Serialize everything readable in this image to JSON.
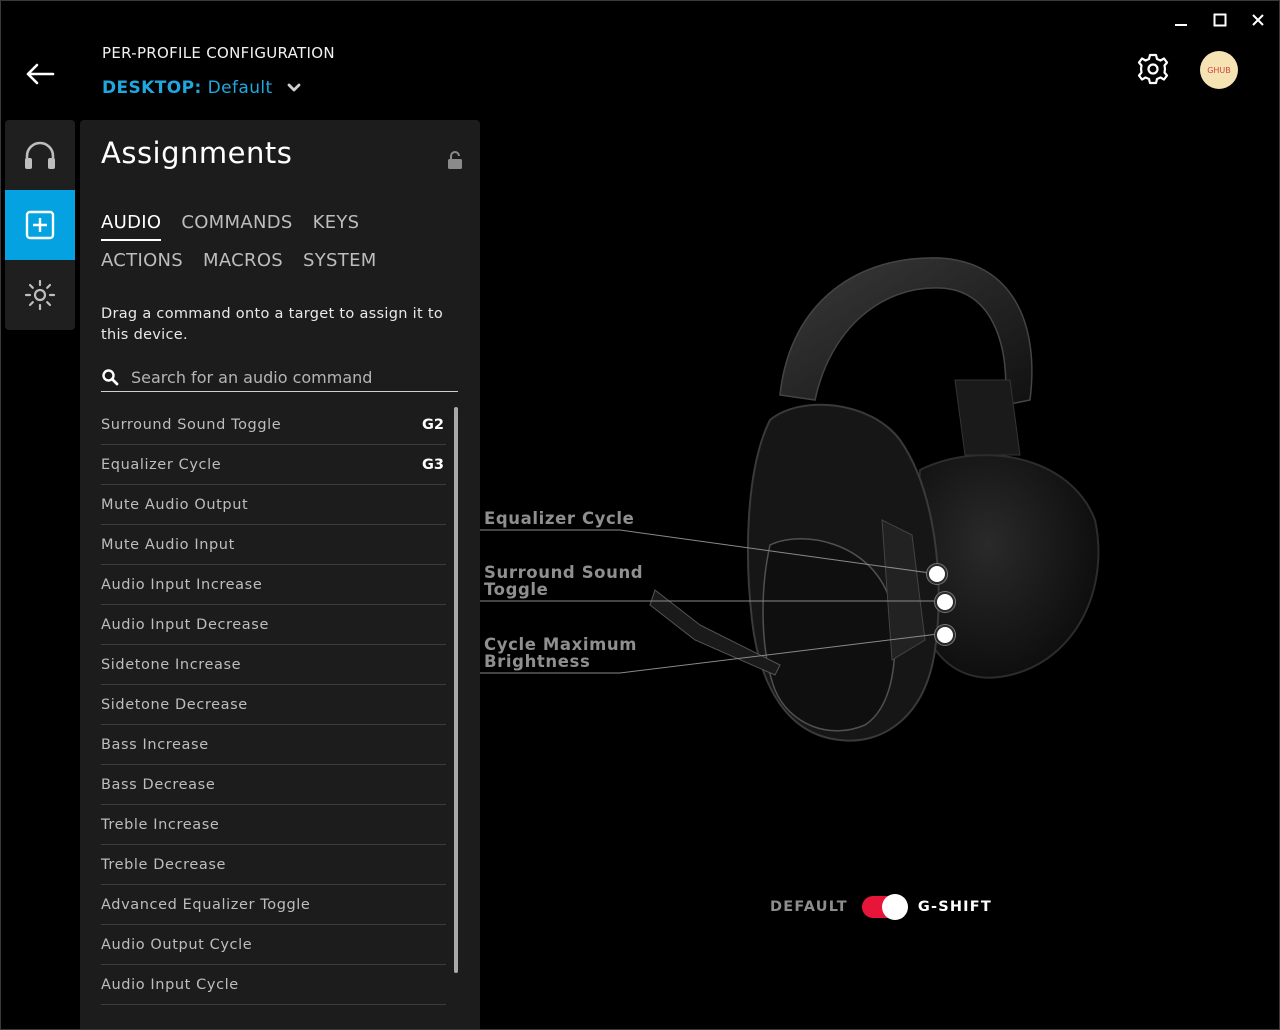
{
  "header": {
    "title": "PER-PROFILE CONFIGURATION",
    "profile_label": "DESKTOP:",
    "profile_value": "Default"
  },
  "avatar": {
    "initials": "GHUB"
  },
  "panel": {
    "title": "Assignments",
    "tabs_row1": [
      "AUDIO",
      "COMMANDS",
      "KEYS"
    ],
    "tabs_row2": [
      "ACTIONS",
      "MACROS",
      "SYSTEM"
    ],
    "active_tab": "AUDIO",
    "hint": "Drag a command onto a target to assign it to this device.",
    "search_placeholder": "Search for an audio command"
  },
  "commands": [
    {
      "name": "Surround Sound Toggle",
      "key": "G2"
    },
    {
      "name": "Equalizer Cycle",
      "key": "G3"
    },
    {
      "name": "Mute Audio Output",
      "key": ""
    },
    {
      "name": "Mute Audio Input",
      "key": ""
    },
    {
      "name": "Audio Input Increase",
      "key": ""
    },
    {
      "name": "Audio Input Decrease",
      "key": ""
    },
    {
      "name": "Sidetone Increase",
      "key": ""
    },
    {
      "name": "Sidetone Decrease",
      "key": ""
    },
    {
      "name": "Bass Increase",
      "key": ""
    },
    {
      "name": "Bass Decrease",
      "key": ""
    },
    {
      "name": "Treble Increase",
      "key": ""
    },
    {
      "name": "Treble Decrease",
      "key": ""
    },
    {
      "name": "Advanced Equalizer Toggle",
      "key": ""
    },
    {
      "name": "Audio Output Cycle",
      "key": ""
    },
    {
      "name": "Audio Input Cycle",
      "key": ""
    }
  ],
  "callouts": {
    "g3": {
      "line1": "Equalizer Cycle",
      "line2": ""
    },
    "g2": {
      "line1": "Surround Sound",
      "line2": "Toggle"
    },
    "g1": {
      "line1": "Cycle Maximum",
      "line2": "Brightness"
    }
  },
  "gshift": {
    "left_label": "DEFAULT",
    "right_label": "G-SHIFT",
    "enabled": true
  },
  "colors": {
    "accent": "#05a2e2",
    "toggle": "#e8153b",
    "panel": "#1c1c1c",
    "rail": "#1f1f1f"
  }
}
